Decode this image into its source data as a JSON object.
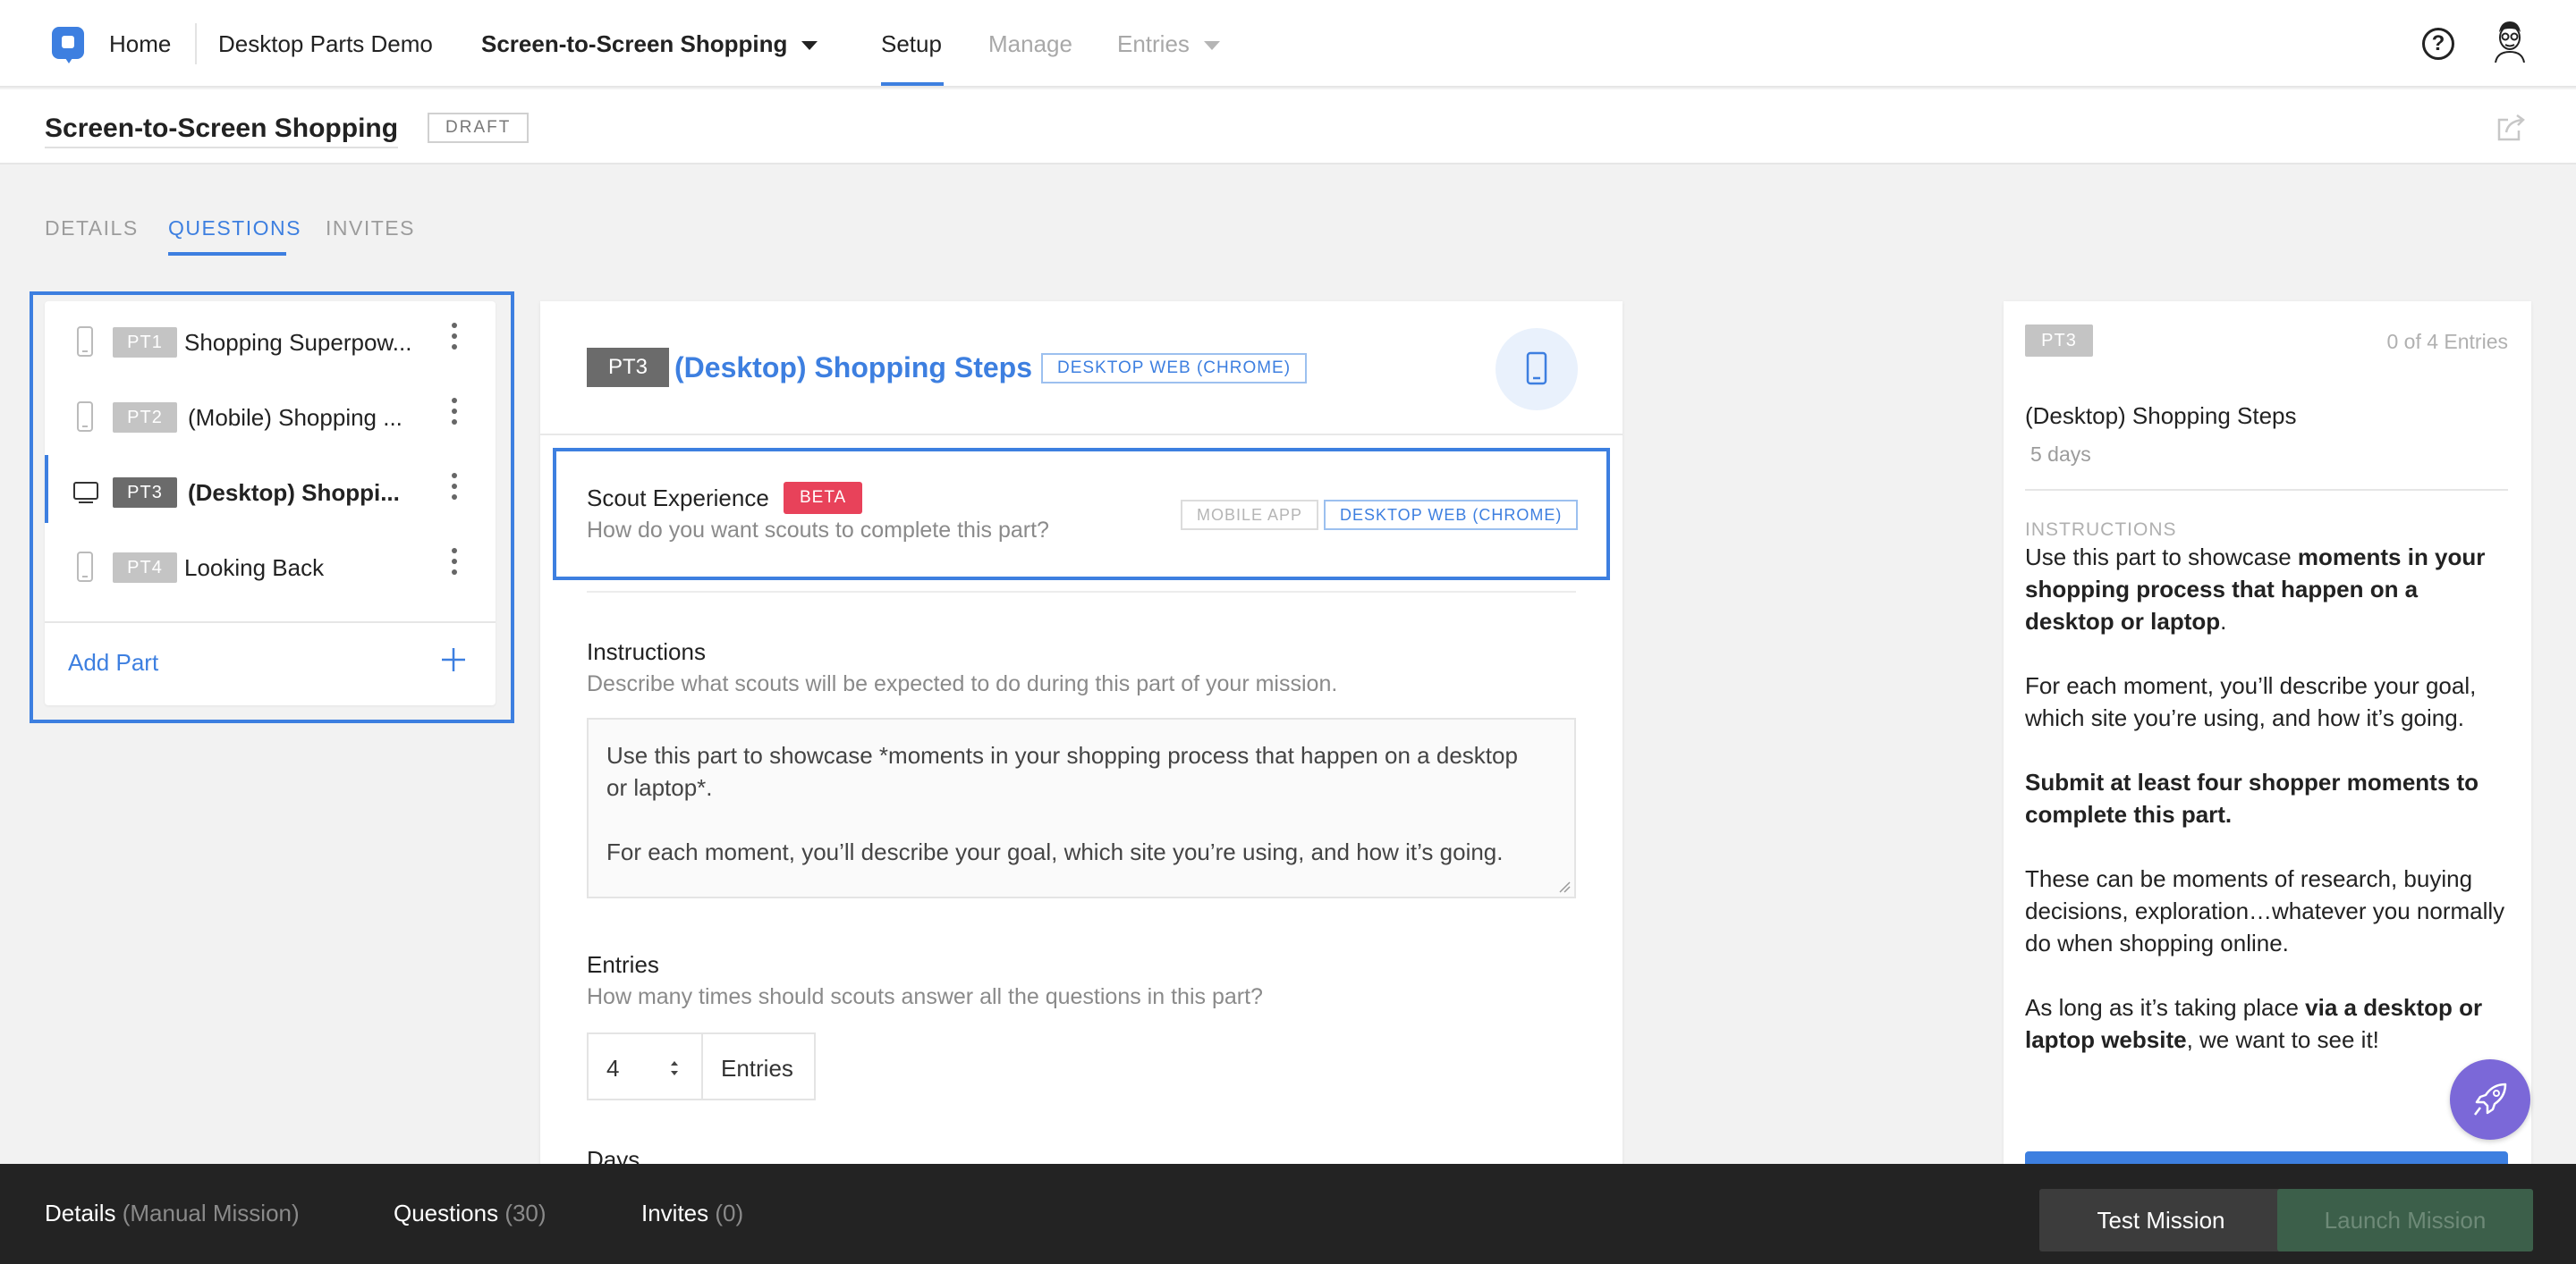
{
  "nav": {
    "home": "Home",
    "project": "Desktop Parts Demo",
    "mission": "Screen-to-Screen Shopping",
    "setup": "Setup",
    "manage": "Manage",
    "entries": "Entries",
    "help": "?"
  },
  "header": {
    "title": "Screen-to-Screen Shopping",
    "status": "DRAFT"
  },
  "tabs": {
    "details": "DETAILS",
    "questions": "QUESTIONS",
    "invites": "INVITES"
  },
  "parts": [
    {
      "badge": "PT1",
      "label": "Shopping Superpow...",
      "device": "mobile"
    },
    {
      "badge": "PT2",
      "label": "(Mobile) Shopping ...",
      "device": "mobile"
    },
    {
      "badge": "PT3",
      "label": "(Desktop) Shoppi...",
      "device": "desktop"
    },
    {
      "badge": "PT4",
      "label": "Looking Back",
      "device": "mobile"
    }
  ],
  "add_part": "Add Part",
  "editor": {
    "badge": "PT3",
    "title": "(Desktop) Shopping Steps",
    "platform_chip": "DESKTOP WEB (CHROME)",
    "scout_experience": {
      "title": "Scout Experience",
      "badge": "BETA",
      "subtitle": "How do you want scouts to complete this part?",
      "option_mobile": "MOBILE APP",
      "option_desktop": "DESKTOP WEB (CHROME)"
    },
    "instructions": {
      "title": "Instructions",
      "subtitle": "Describe what scouts will be expected to do during this part of your mission.",
      "line1": "Use this part to showcase *moments in your shopping process that happen on a desktop",
      "line2": "or laptop*.",
      "line3": "For each moment, you’ll describe your goal, which site you’re using, and how it’s going."
    },
    "entries": {
      "title": "Entries",
      "subtitle": "How many times should scouts answer all the questions in this part?",
      "value": "4",
      "unit": "Entries"
    },
    "days_title": "Days"
  },
  "preview": {
    "badge": "PT3",
    "entries": "0 of 4 Entries",
    "title": "(Desktop) Shopping Steps",
    "days": "5 days",
    "instructions_label": "INSTRUCTIONS",
    "p1_a": "Use this part to showcase ",
    "p1_b": "moments in your shopping process that happen on a desktop or laptop",
    "p1_c": ".",
    "p2": "For each moment, you’ll describe your goal, which site you’re using, and how it’s going.",
    "p3": "Submit at least four shopper moments to complete this part.",
    "p4": "These can be moments of research, buying decisions, exploration…whatever you normally do when shopping online.",
    "p5_a": "As long as it’s taking place ",
    "p5_b": "via a desktop or laptop website",
    "p5_c": ", we want to see it!"
  },
  "bottom": {
    "details": "Details",
    "details_meta": "(Manual Mission)",
    "questions": "Questions",
    "questions_meta": "(30)",
    "invites": "Invites",
    "invites_meta": "(0)",
    "test": "Test Mission",
    "launch": "Launch Mission"
  },
  "colors": {
    "accent": "#3d7fe0",
    "beta": "#e8425a",
    "bottom_bar": "#232323",
    "launch_disabled": "#3c5f4a",
    "rocket": "#7b68d8"
  }
}
